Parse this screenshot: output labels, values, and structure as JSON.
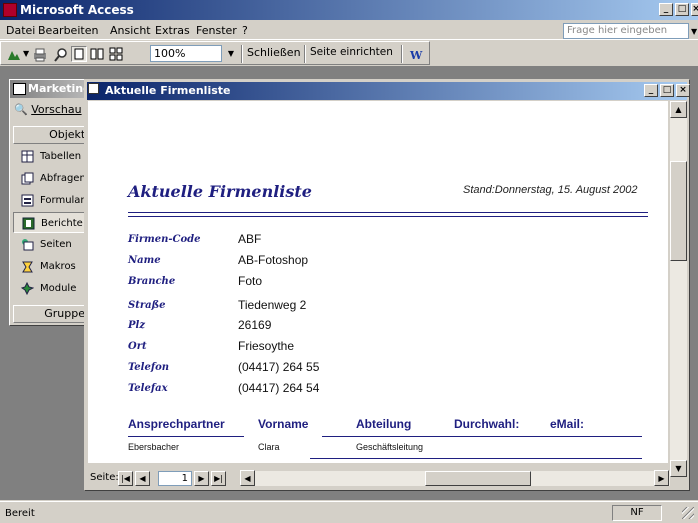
{
  "app": {
    "title": "Microsoft Access"
  },
  "menu": [
    "Datei",
    "Bearbeiten",
    "Ansicht",
    "Extras",
    "Fenster",
    "?"
  ],
  "ask_placeholder": "Frage hier eingeben",
  "toolbar": {
    "zoom": "100%",
    "close_label": "Schließen",
    "setup_label": "Seite einrichten"
  },
  "db_window": {
    "title": "Marketing",
    "preview_label": "Vorschau",
    "objects_header": "Objekte",
    "items": [
      "Tabellen",
      "Abfragen",
      "Formulare",
      "Berichte",
      "Seiten",
      "Makros",
      "Module"
    ],
    "groups_header": "Gruppen"
  },
  "report_window": {
    "title": "Aktuelle Firmenliste",
    "report_title": "Aktuelle Firmenliste",
    "date": "Stand:Donnerstag, 15. August 2002",
    "fields": [
      {
        "label": "Firmen-Code",
        "value": "ABF"
      },
      {
        "label": "Name",
        "value": "AB-Fotoshop"
      },
      {
        "label": "Branche",
        "value": "Foto"
      },
      {
        "label": "Straße",
        "value": "Tiedenweg 2"
      },
      {
        "label": "Plz",
        "value": "26169"
      },
      {
        "label": "Ort",
        "value": "Friesoythe"
      },
      {
        "label": "Telefon",
        "value": "(04417) 264 55"
      },
      {
        "label": "Telefax",
        "value": "(04417) 264 54"
      }
    ],
    "columns": [
      "Ansprechpartner",
      "Vorname",
      "Abteilung",
      "Durchwahl:",
      "eMail:"
    ],
    "row": [
      "Ebersbacher",
      "Clara",
      "Geschäftsleitung"
    ],
    "nav_label": "Seite:",
    "page": "1"
  },
  "status": {
    "left": "Bereit",
    "right": "NF"
  }
}
